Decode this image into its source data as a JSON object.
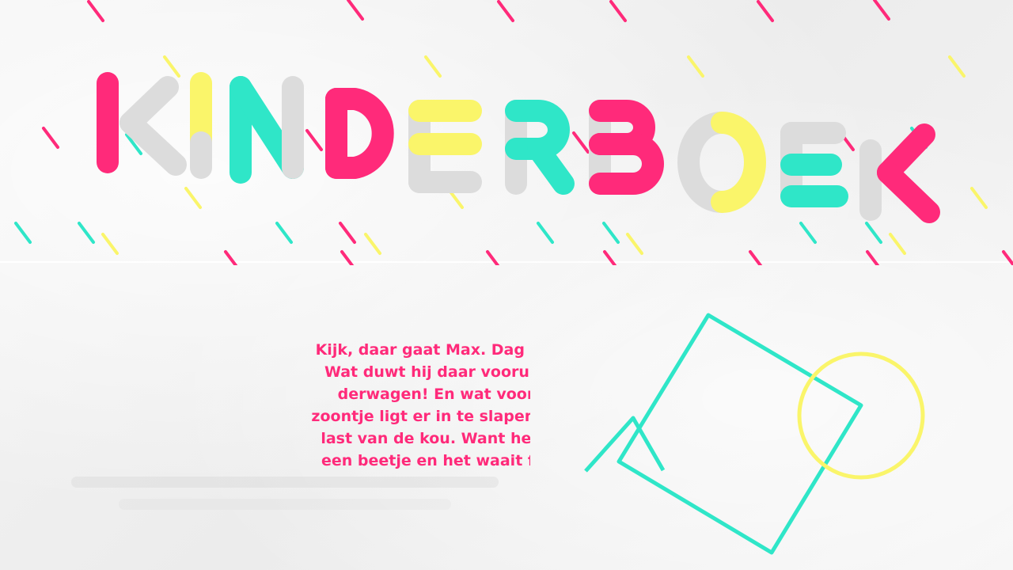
{
  "title": {
    "letters": [
      "K",
      "I",
      "N",
      "D",
      "E",
      "R",
      "B",
      "O",
      "E",
      "K"
    ]
  },
  "colors": {
    "pink": "#ff2a7a",
    "teal": "#2fe6c8",
    "yellow": "#faf56a",
    "grey": "#dcdcdc",
    "background": "#f2f2f2"
  },
  "story": {
    "lines": [
      "Kijk, daar gaat Max. Dag Max! Hij stapt uit de bus.",
      "Wat duwt hij daar vooruit? Jawel, een heuse kin-",
      "derwagen! En wat voor één! Een groene! Zijn",
      "zoontje ligt er in te slapen. Die heeft gelukkig geen",
      "last van de kou. Want het is koud joh! Het regent",
      "een beetje en het waait flink. Alle mensen op het"
    ]
  }
}
